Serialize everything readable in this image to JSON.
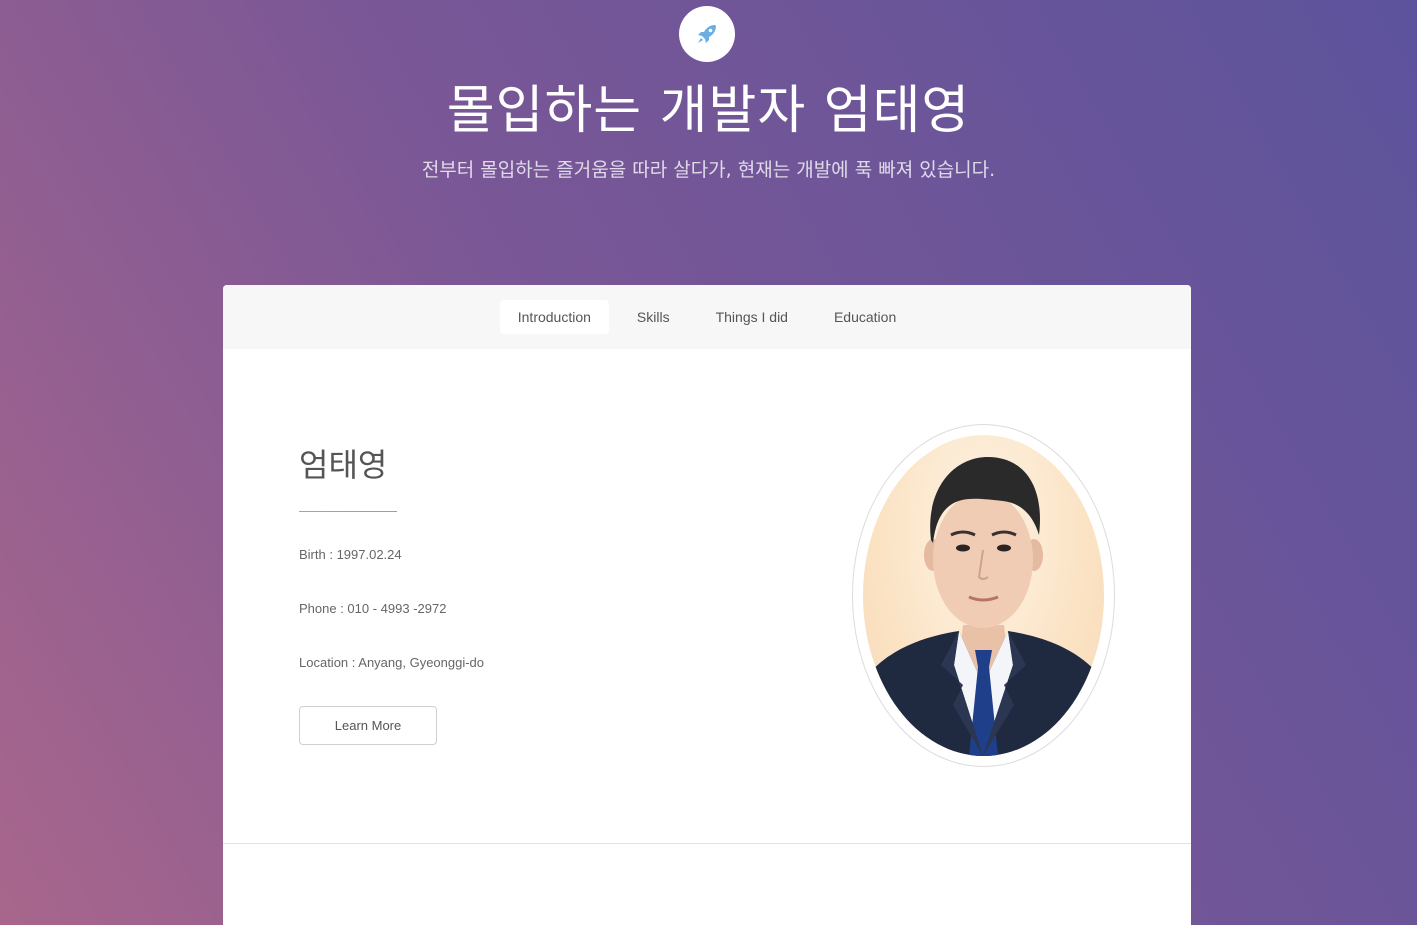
{
  "header": {
    "logo_icon": "rocket-icon",
    "title": "몰입하는 개발자 엄태영",
    "subtitle": "전부터 몰입하는 즐거움을 따라 살다가, 현재는 개발에 푹 빠져 있습니다."
  },
  "nav": {
    "tabs": [
      {
        "label": "Introduction",
        "active": true
      },
      {
        "label": "Skills",
        "active": false
      },
      {
        "label": "Things I did",
        "active": false
      },
      {
        "label": "Education",
        "active": false
      }
    ]
  },
  "intro": {
    "name": "엄태영",
    "birth": "Birth : 1997.02.24",
    "phone": "Phone : 010 - 4993 -2972",
    "location": "Location : Anyang, Gyeonggi-do",
    "button_label": "Learn More"
  },
  "colors": {
    "gradient_start": "#a8668c",
    "gradient_end": "#5c539c",
    "rocket_icon": "#6aaee6"
  }
}
